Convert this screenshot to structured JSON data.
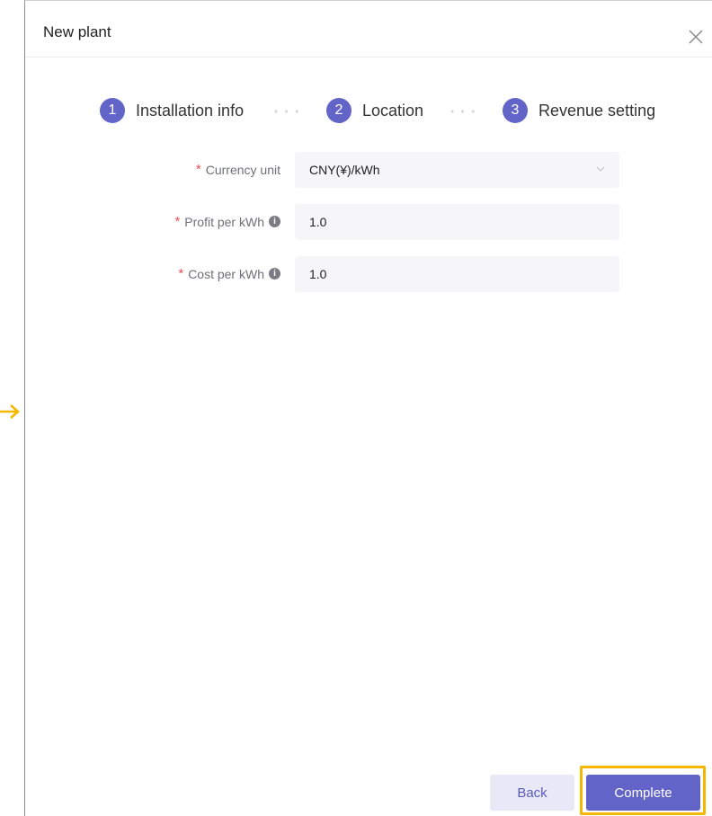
{
  "dialog": {
    "title": "New plant"
  },
  "steps": [
    {
      "number": "1",
      "label": "Installation info"
    },
    {
      "number": "2",
      "label": "Location"
    },
    {
      "number": "3",
      "label": "Revenue setting"
    }
  ],
  "step_separator": "• • •",
  "form": {
    "required_mark": "*",
    "info_glyph": "i",
    "currency": {
      "label": "Currency unit",
      "value": "CNY(¥)/kWh"
    },
    "profit": {
      "label": "Profit per kWh",
      "value": "1.0"
    },
    "cost": {
      "label": "Cost per kWh",
      "value": "1.0"
    }
  },
  "buttons": {
    "back": "Back",
    "complete": "Complete"
  },
  "colors": {
    "accent": "#6265c7",
    "highlight": "#f5b700",
    "required": "#f0515a"
  }
}
